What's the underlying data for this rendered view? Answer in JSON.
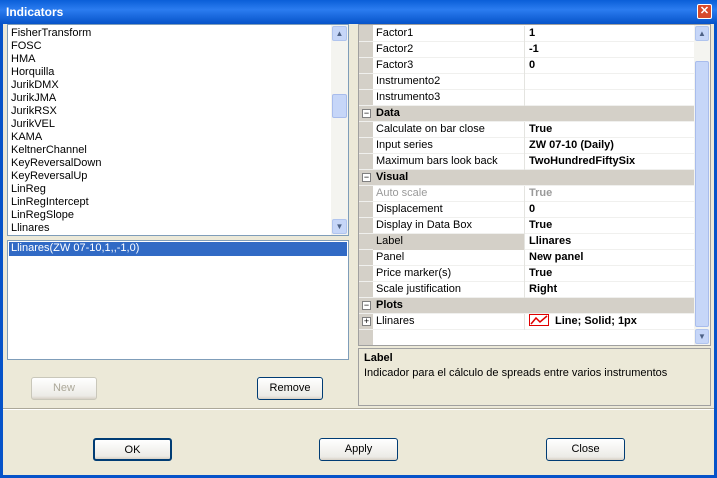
{
  "window": {
    "title": "Indicators",
    "close_icon": "close-icon"
  },
  "indicator_list": [
    "FisherTransform",
    "FOSC",
    "HMA",
    "Horquilla",
    "JurikDMX",
    "JurikJMA",
    "JurikRSX",
    "JurikVEL",
    "KAMA",
    "KeltnerChannel",
    "KeyReversalDown",
    "KeyReversalUp",
    "LinReg",
    "LinRegIntercept",
    "LinRegSlope",
    "Llinares"
  ],
  "applied_list": [
    {
      "label": "Llinares(ZW 07-10,1,,-1,0)",
      "selected": true
    }
  ],
  "buttons": {
    "new": "New",
    "remove": "Remove",
    "ok": "OK",
    "apply": "Apply",
    "close": "Close"
  },
  "properties": [
    {
      "name": "Factor1",
      "value": "1"
    },
    {
      "name": "Factor2",
      "value": "-1"
    },
    {
      "name": "Factor3",
      "value": "0"
    },
    {
      "name": "Instrumento2",
      "value": ""
    },
    {
      "name": "Instrumento3",
      "value": ""
    },
    {
      "category": "Data"
    },
    {
      "name": "Calculate on bar close",
      "value": "True"
    },
    {
      "name": "Input series",
      "value": "ZW 07-10 (Daily)"
    },
    {
      "name": "Maximum bars look back",
      "value": "TwoHundredFiftySix"
    },
    {
      "category": "Visual"
    },
    {
      "name": "Auto scale",
      "value": "True",
      "disabled": true
    },
    {
      "name": "Displacement",
      "value": "0"
    },
    {
      "name": "Display in Data Box",
      "value": "True"
    },
    {
      "name": "Label",
      "value": "Llinares",
      "selected": true
    },
    {
      "name": "Panel",
      "value": "New panel"
    },
    {
      "name": "Price marker(s)",
      "value": "True"
    },
    {
      "name": "Scale justification",
      "value": "Right"
    },
    {
      "category": "Plots"
    },
    {
      "name": "Llinares",
      "value": "Line; Solid; 1px",
      "expandable": true,
      "plot_color": "#e00000"
    }
  ],
  "description": {
    "title": "Label",
    "text": "Indicador para el cálculo de spreads entre varios instrumentos"
  }
}
